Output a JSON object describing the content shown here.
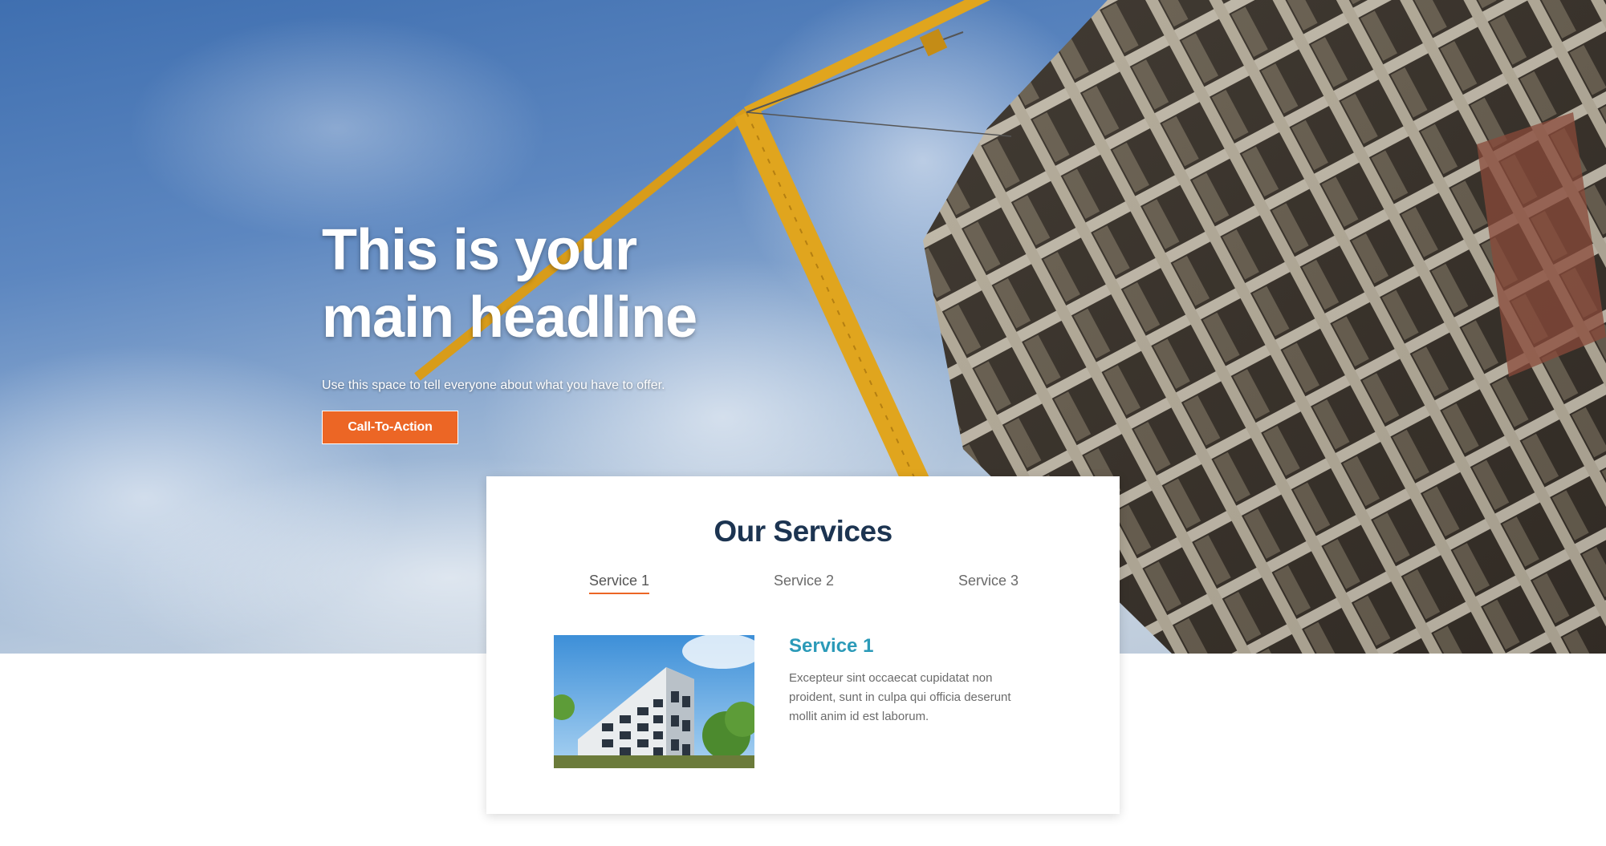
{
  "hero": {
    "headline": "This is your main headline",
    "subline": "Use this space to tell everyone about what you have to offer.",
    "cta_label": "Call-To-Action"
  },
  "services": {
    "title": "Our Services",
    "tabs": [
      {
        "label": "Service 1",
        "active": true
      },
      {
        "label": "Service 2",
        "active": false
      },
      {
        "label": "Service 3",
        "active": false
      }
    ],
    "panel": {
      "title": "Service 1",
      "text": "Excepteur sint occaecat cupidatat non proident, sunt in culpa qui officia deserunt mollit anim id est laborum."
    }
  },
  "colors": {
    "accent": "#ec6625",
    "title_dark": "#1c3451",
    "service_title": "#2b9ab8",
    "sky": "#4a78b6"
  },
  "images": {
    "hero_background": "construction-crane-building-photo",
    "service_image": "apartment-building-photo"
  }
}
